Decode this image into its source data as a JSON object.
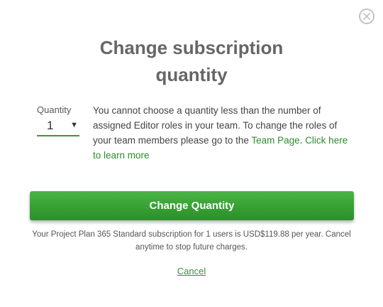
{
  "dialog": {
    "title_line1": "Change subscription",
    "title_line2": "quantity",
    "close_icon": "close-circle-icon"
  },
  "quantity": {
    "label": "Quantity",
    "selected": "1",
    "caret": "▼"
  },
  "info": {
    "text": "You cannot choose a quantity less than the number of assigned Editor roles in your team. To change the roles of your team members please go to the ",
    "team_page_link": "Team Page",
    "separator": ". ",
    "learn_more_link": "Click here to learn more"
  },
  "actions": {
    "primary_label": "Change Quantity",
    "cancel_label": "Cancel"
  },
  "notice": {
    "text": "Your Project Plan 365 Standard subscription for 1 users is USD$119.88 per year. Cancel anytime to stop future charges."
  },
  "colors": {
    "accent_green": "#3a9a3a",
    "button_green": "#37a033",
    "title_gray": "#666666"
  }
}
